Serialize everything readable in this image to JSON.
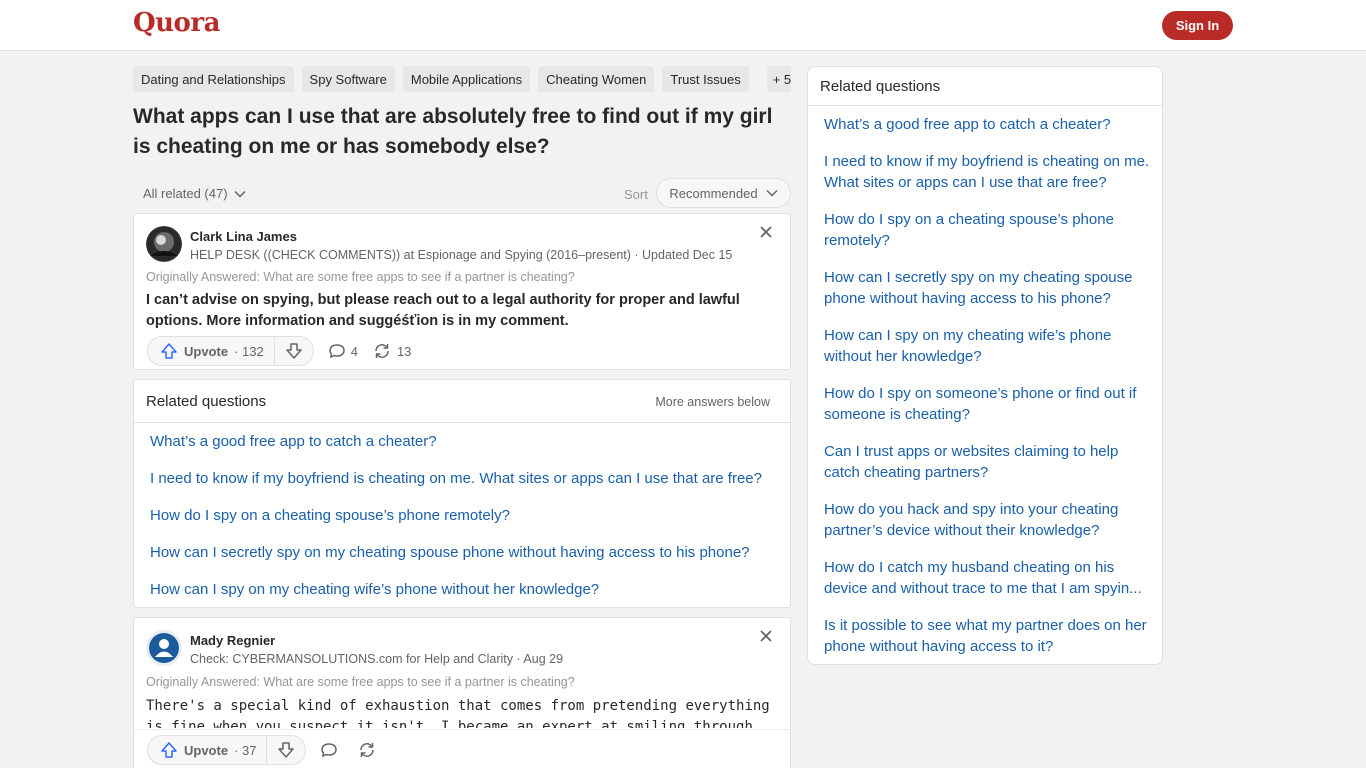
{
  "header": {
    "logo": "Quora",
    "signin_label": "Sign In"
  },
  "topics": [
    "Dating and Relationships",
    "Spy Software",
    "Mobile Applications",
    "Cheating Women",
    "Trust Issues"
  ],
  "topics_more": "+ 5",
  "question": {
    "title": "What apps can I use that are absolutely free to find out if my girl is cheating on me or has somebody else?"
  },
  "sortbar": {
    "all_related": "All related (47)",
    "sort_label": "Sort",
    "sort_value": "Recommended"
  },
  "answers": [
    {
      "author": "Clark Lina James",
      "credential": "HELP DESK ((CHECK COMMENTS)) at Espionage and Spying (2016–present) · Updated Dec 15",
      "originally": "Originally Answered: What are some free apps to see if a partner is cheating?",
      "text": "I can’t advise on spying, but please reach out to a legal authority for proper and lawful options. More information and suggéśťion is in my comment.",
      "upvote_label": "Upvote",
      "upvotes": "· 132",
      "comments": "4",
      "shares": "13"
    },
    {
      "author": "Mady Regnier",
      "credential": "Check: CYBERMANSOLUTIONS.com for Help and Clarity · Aug 29",
      "originally": "Originally Answered: What are some free apps to see if a partner is cheating?",
      "text": "There's a special kind of exhaustion that comes from pretending everything is fine when you suspect it isn't. I became an expert at smiling through",
      "upvote_label": "Upvote",
      "upvotes": "· 37",
      "comments": "",
      "shares": ""
    }
  ],
  "inline_related": {
    "title": "Related questions",
    "more": "More answers below",
    "items": [
      "What’s a good free app to catch a cheater?",
      "I need to know if my boyfriend is cheating on me. What sites or apps can I use that are free?",
      "How do I spy on a cheating spouse’s phone remotely?",
      "How can I secretly spy on my cheating spouse phone without having access to his phone?",
      "How can I spy on my cheating wife’s phone without her knowledge?"
    ]
  },
  "sidebar": {
    "title": "Related questions",
    "items": [
      "What’s a good free app to catch a cheater?",
      "I need to know if my boyfriend is cheating on me. What sites or apps can I use that are free?",
      "How do I spy on a cheating spouse’s phone remotely?",
      "How can I secretly spy on my cheating spouse phone without having access to his phone?",
      "How can I spy on my cheating wife’s phone without her knowledge?",
      "How do I spy on someone’s phone or find out if someone is cheating?",
      "Can I trust apps or websites claiming to help catch cheating partners?",
      "How do you hack and spy into your cheating partner’s device without their knowledge?",
      "How do I catch my husband cheating on his device and without trace to me that I am spyin...",
      "Is it possible to see what my partner does on her phone without having access to it?"
    ]
  },
  "colors": {
    "brand": "#b92b27",
    "link": "#195faa"
  }
}
